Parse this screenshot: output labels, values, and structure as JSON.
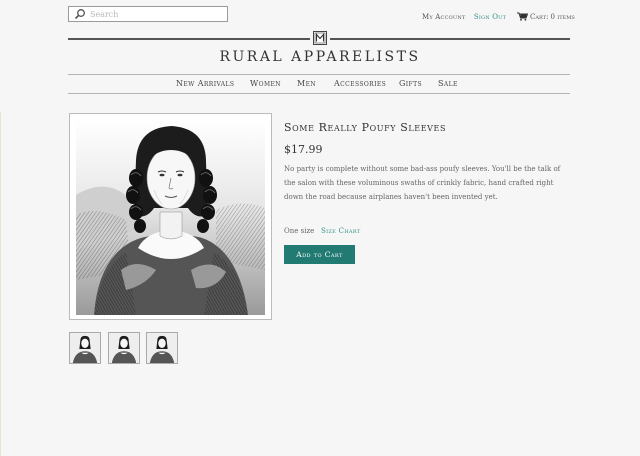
{
  "search": {
    "placeholder": "Search",
    "icon": "search-icon"
  },
  "account": {
    "my_account": "My Account",
    "sign_out": "Sign Out"
  },
  "cart": {
    "label": "Cart: 0 items",
    "icon": "cart-icon"
  },
  "brand": {
    "name": "RURAL APPARELISTS",
    "logo_icon": "monogram-logo"
  },
  "nav": {
    "items": [
      {
        "label": "New Arrivals"
      },
      {
        "label": "Women"
      },
      {
        "label": "Men"
      },
      {
        "label": "Accessories"
      },
      {
        "label": "Gifts"
      },
      {
        "label": "Sale"
      }
    ]
  },
  "product": {
    "title": "Some Really Poufy Sleeves",
    "price": "$17.99",
    "description": "No party is complete without some bad-ass poufy sleeves. You'll be the talk of the salon with these voluminous swaths of crinkly fabric, hand crafted right down the road because airplanes haven't been invented yet.",
    "size_label": "One size",
    "size_chart": "Size Chart",
    "add_to_cart": "Add to Cart",
    "thumbnail_count": 3
  },
  "colors": {
    "accent": "#227b73",
    "link": "#2f8f86",
    "background": "#f6f6f6"
  }
}
